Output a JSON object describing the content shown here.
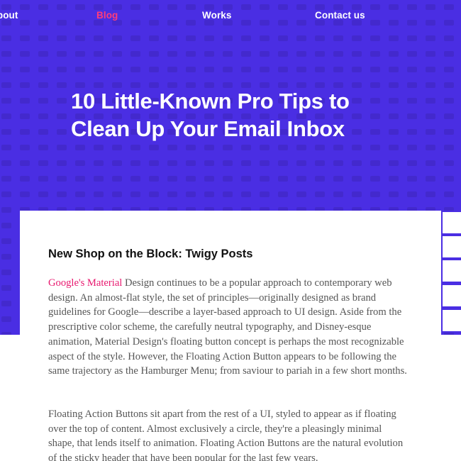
{
  "nav": {
    "items": [
      {
        "label": "About",
        "active": false
      },
      {
        "label": "Blog",
        "active": true
      },
      {
        "label": "Works",
        "active": false
      },
      {
        "label": "Contact us",
        "active": false
      }
    ]
  },
  "hero": {
    "title_line1": "10 Little-Known Pro Tips to",
    "title_line2": "Clean Up Your Email Inbox"
  },
  "article": {
    "heading": "New Shop on the Block: Twigy Posts",
    "para1_link": "Google's Material",
    "para1_text": " Design continues to be a popular approach to contemporary web design. An almost-flat style, the set of principles—originally designed as brand guidelines for Google—describe a layer-based approach to UI design. Aside from the prescriptive color scheme, the carefully neutral typography, and Disney-esque animation, Material Design's floating button concept is perhaps the most recognizable aspect of the style. However, the Floating Action Button appears to be following the same trajectory as the Hamburger Menu; from saviour to pariah in a few short months.",
    "para2_text": "Floating Action Buttons sit apart from the rest of a UI, styled to appear as if floating over the top of content. Almost exclusively a circle, they're a pleasingly minimal shape, that lends itself to animation. Floating Action Buttons are the natural evolution of the sticky header that have been popular for the last few years."
  },
  "colors": {
    "hero_bg": "#4a2ee3",
    "nav_active": "#ff3c7a",
    "link": "#e8176e",
    "body_text": "#555555",
    "heading_text": "#111111"
  }
}
